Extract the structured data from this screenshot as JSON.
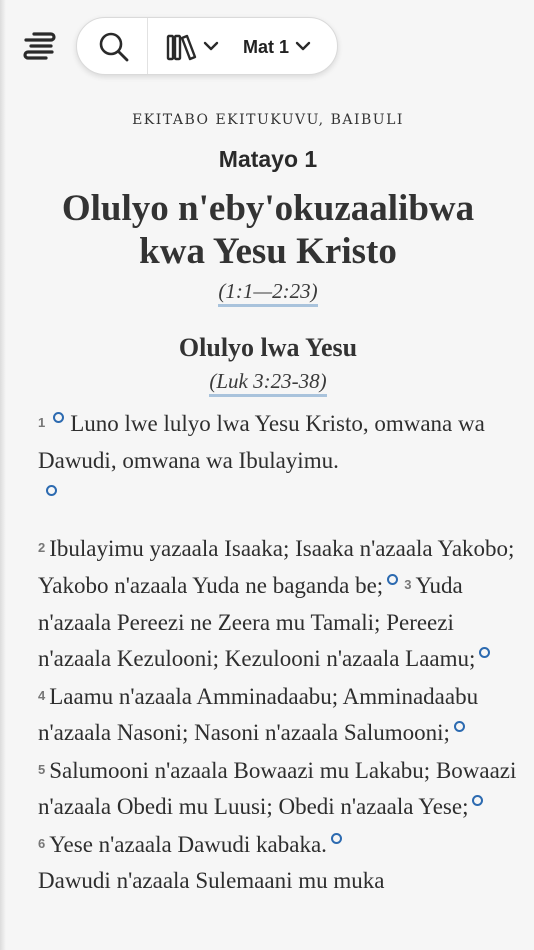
{
  "header": {
    "chapter_label": "Mat 1"
  },
  "reader": {
    "version_name": "EKITABO EKITUKUVU, BAIBULI",
    "book_ref": "Matayo 1",
    "main_heading_line1": "Olulyo n'eby'okuzaalibwa",
    "main_heading_line2": "kwa Yesu Kristo",
    "main_heading_ref": "(1:1—2:23)",
    "section_heading": "Olulyo lwa Yesu",
    "section_ref": "(Luk 3:23-38)",
    "verses": [
      {
        "num": "1",
        "text": "Luno lwe lulyo lwa Yesu Kristo, omwana wa Dawudi, omwana wa Ibulayimu."
      },
      {
        "num": "2",
        "text": "Ibulayimu yazaala Isaaka; Isaaka n'azaala Yakobo; Yakobo n'azaala Yuda ne baganda be;"
      },
      {
        "num": "3",
        "text": "Yuda n'azaala Pereezi ne Zeera mu Tamali; Pereezi n'azaala Kezulooni; Kezulooni n'azaala Laamu;"
      },
      {
        "num": "4",
        "text": "Laamu n'azaala Amminadaabu; Amminadaabu n'azaala Nasoni; Nasoni n'azaala Salumooni;"
      },
      {
        "num": "5",
        "text": "Salumooni n'azaala Bowaazi mu Lakabu; Bowaazi n'azaala Obedi mu Luusi; Obedi n'azaala Yese;"
      },
      {
        "num": "6",
        "text": "Yese n'azaala Dawudi kabaka."
      },
      {
        "num": "",
        "text": "Dawudi n'azaala Sulemaani mu muka"
      }
    ]
  },
  "colors": {
    "accent": "#2c6ab0",
    "ref_underline": "#a9c3dc",
    "background": "#f6f6f6"
  },
  "icons": [
    "menu-icon",
    "search-icon",
    "versions-icon",
    "chevron-down-icon",
    "footnote-marker-icon"
  ]
}
